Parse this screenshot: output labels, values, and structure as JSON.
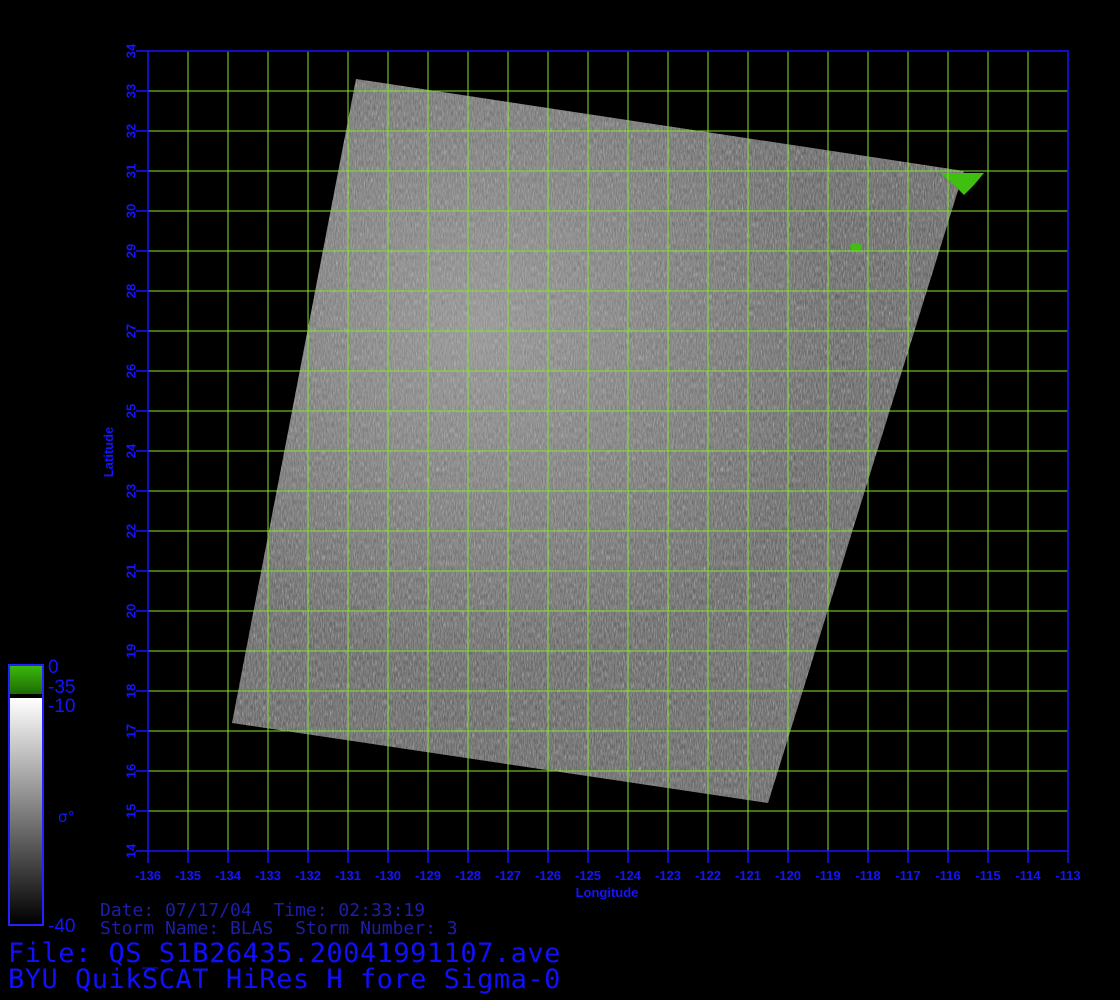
{
  "colors": {
    "axis": "#1414ff",
    "grid": "#7ee62c",
    "land": "#3fbf0f",
    "background": "#000000"
  },
  "axes": {
    "x_label": "Longitude",
    "y_label": "Latitude",
    "x_ticks": [
      "-136",
      "-135",
      "-134",
      "-133",
      "-132",
      "-131",
      "-130",
      "-129",
      "-128",
      "-127",
      "-126",
      "-125",
      "-124",
      "-123",
      "-122",
      "-121",
      "-120",
      "-119",
      "-118",
      "-117",
      "-116",
      "-115",
      "-114",
      "-113"
    ],
    "y_ticks": [
      "14",
      "15",
      "16",
      "17",
      "18",
      "19",
      "20",
      "21",
      "22",
      "23",
      "24",
      "25",
      "26",
      "27",
      "28",
      "29",
      "30",
      "31",
      "32",
      "33",
      "34"
    ]
  },
  "map": {
    "lon_range": [
      -136,
      -113
    ],
    "lat_range": [
      14,
      34
    ],
    "grid_step_deg": 1,
    "swath_corners_lonlat": [
      [
        -130.8,
        33.3
      ],
      [
        -115.6,
        31.0
      ],
      [
        -120.5,
        15.2
      ],
      [
        -133.9,
        17.2
      ]
    ]
  },
  "colorbar": {
    "label": "σ°",
    "ticks": [
      "0",
      "-35",
      "-10",
      "-40"
    ],
    "green_range": [
      "0",
      "-35"
    ],
    "gray_range": [
      "-10",
      "-40"
    ]
  },
  "info": {
    "date_line": "Date: 07/17/04  Time: 02:33:19",
    "storm_line": "Storm Name: BLAS  Storm Number: 3",
    "file_line": "File: QS_S1B26435.20041991107.ave",
    "product_line": "BYU QuikSCAT HiRes H fore Sigma-0"
  }
}
